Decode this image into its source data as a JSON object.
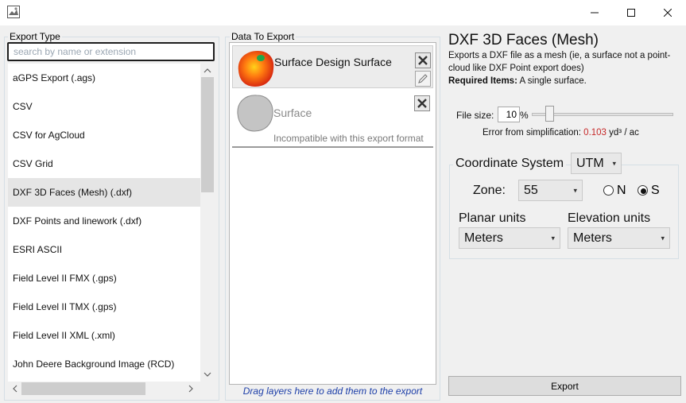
{
  "export_type": {
    "group_label": "Export Type",
    "search_placeholder": "search by name or extension",
    "items": [
      "aGPS Export (.ags)",
      "CSV",
      "CSV for AgCloud",
      "CSV Grid",
      "DXF 3D Faces (Mesh) (.dxf)",
      "DXF Points and linework (.dxf)",
      "ESRI ASCII",
      "Field Level II FMX (.gps)",
      "Field Level II TMX (.gps)",
      "Field Level II XML (.xml)",
      "John Deere Background Image (RCD)"
    ],
    "selected_index": 4
  },
  "data_to_export": {
    "group_label": "Data To Export",
    "layers": [
      {
        "name": "Surface Design Surface",
        "compatible": true
      },
      {
        "name": "Surface",
        "compatible": false,
        "note": "Incompatible with this export format"
      }
    ],
    "drag_hint": "Drag layers here to add them to the export"
  },
  "format": {
    "title": "DXF 3D Faces (Mesh)",
    "description": "Exports a DXF file as a mesh (ie, a surface not a point-cloud like DXF Point export does)",
    "required_label": "Required Items:",
    "required_value": "A single surface."
  },
  "file_size": {
    "label": "File size:",
    "value": "10",
    "unit": "%",
    "slider_fraction": 0.1,
    "error_label": "Error from simplification:",
    "error_value": "0.103",
    "error_unit": "yd³ / ac"
  },
  "coordinate_system": {
    "label": "Coordinate System",
    "value": "UTM",
    "zone_label": "Zone:",
    "zone_value": "55",
    "hemisphere_n": "N",
    "hemisphere_s": "S",
    "hemisphere_selected": "S",
    "planar_label": "Planar units",
    "planar_value": "Meters",
    "elevation_label": "Elevation units",
    "elevation_value": "Meters"
  },
  "export_button": "Export",
  "colors": {
    "error_value": "#c62828",
    "drag_hint": "#1c3ea8",
    "selected_row": "#e5e5e5"
  }
}
